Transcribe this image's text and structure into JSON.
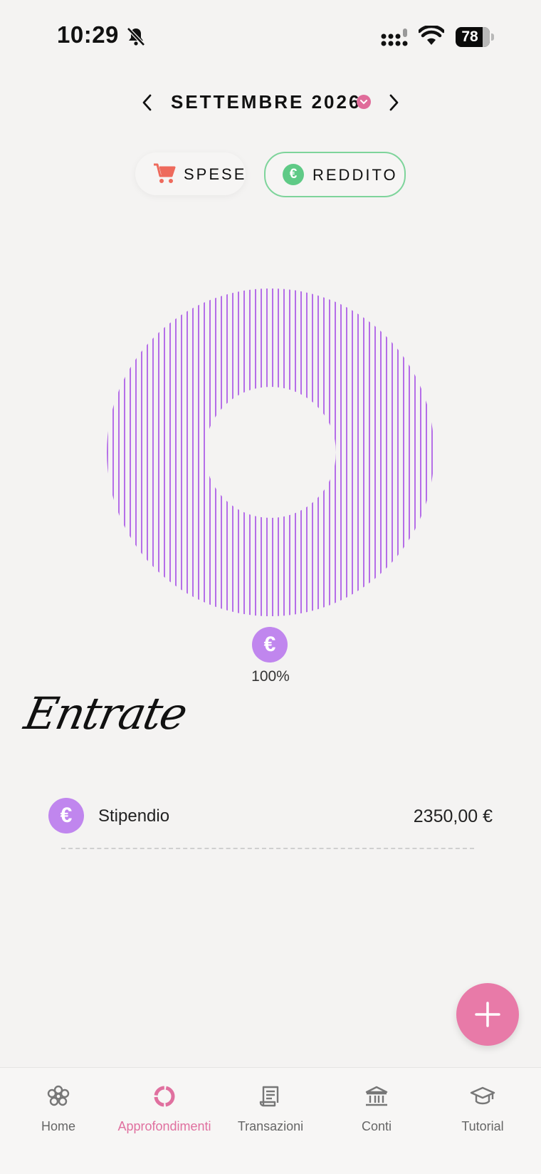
{
  "status_bar": {
    "time": "10:29",
    "battery": "78"
  },
  "header": {
    "month": "SETTEMBRE 2026"
  },
  "toggle": {
    "spese": "SPESE",
    "reddito": "REDDITO",
    "active": "reddito"
  },
  "chart_data": {
    "type": "pie",
    "categories": [
      "Stipendio"
    ],
    "values": [
      100
    ],
    "colors": [
      "#b56ee8"
    ]
  },
  "legend": {
    "icon": "€",
    "percent": "100%"
  },
  "section": {
    "title": "Entrate"
  },
  "entries": [
    {
      "icon": "€",
      "name": "Stipendio",
      "amount": "2350,00 €"
    }
  ],
  "fab": {
    "icon": "plus-icon"
  },
  "nav": [
    {
      "label": "Home",
      "icon": "flower-icon"
    },
    {
      "label": "Approfondimenti",
      "icon": "donut-icon",
      "active": true
    },
    {
      "label": "Transazioni",
      "icon": "receipt-icon"
    },
    {
      "label": "Conti",
      "icon": "bank-icon"
    },
    {
      "label": "Tutorial",
      "icon": "graduation-cap-icon"
    }
  ],
  "colors": {
    "accent": "#e0709f",
    "income": "#5fca86",
    "chart": "#b56ee8"
  }
}
